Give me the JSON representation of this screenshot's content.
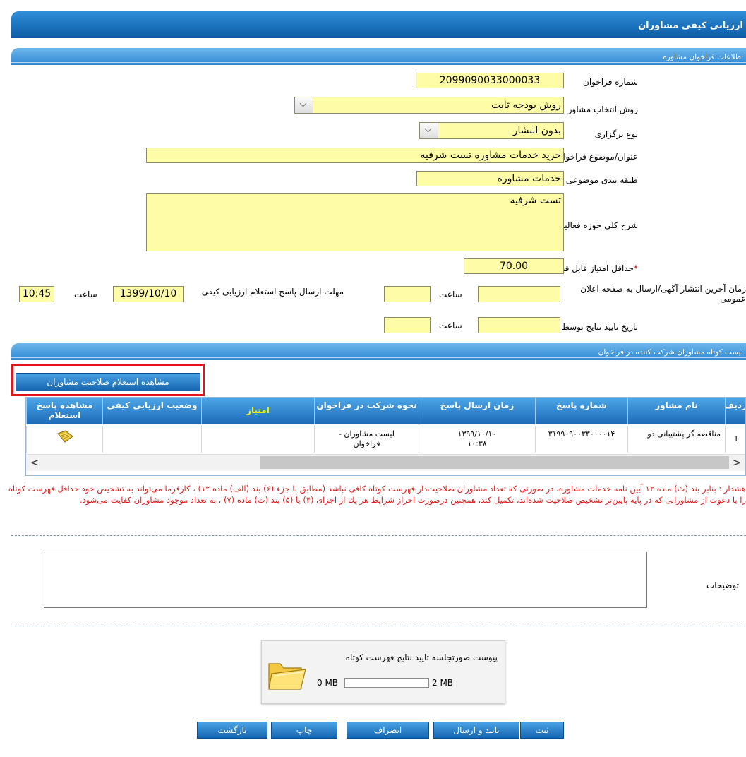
{
  "page": {
    "title": "ارزیابی کیفی مشاوران"
  },
  "sections": {
    "call_info": "اطلاعات فراخوان مشاوره",
    "short_list": "لیست کوتاه مشاوران شرکت کننده در فراخوان"
  },
  "form": {
    "call_number": {
      "label": "شماره فراخوان",
      "value": "2099090033000033"
    },
    "selection_method": {
      "label": "روش انتخاب مشاور",
      "value": "روش بودجه ثابت"
    },
    "holding_type": {
      "label": "نوع برگزاری",
      "value": "بدون انتشار"
    },
    "subject": {
      "label": "عنوان/موضوع فراخوان",
      "value": "خرید خدمات مشاوره تست شرفیه"
    },
    "category": {
      "label": "طبقه بندی موضوعی",
      "value": "خدمات مشاورة"
    },
    "description": {
      "label": "شرح کلی حوزه فعالیت",
      "value": "تست شرفیه"
    },
    "min_score": {
      "label": "حداقل امتیاز قابل قبول ارزیابی کیفی",
      "required_mark": "*",
      "value": "70.00"
    },
    "publish_time": {
      "label": "زمان آخرین انتشار آگهی/ارسال به صفحه اعلان عمومی",
      "date": "",
      "time_label": "ساعت",
      "time": ""
    },
    "response_deadline": {
      "label": "مهلت ارسال پاسخ استعلام ارزیابی کیفی",
      "date": "1399/10/10",
      "time_label": "ساعت",
      "time": "10:45"
    },
    "approval_date": {
      "label": "تاریخ تایید نتایج توسط مقام تشخیص",
      "date": "",
      "time_label": "ساعت",
      "time": ""
    }
  },
  "view_qualification_button": "مشاهده استعلام صلاحیت مشاوران",
  "grid": {
    "headers": {
      "row": "ردیف",
      "name": "نام مشاور",
      "resp_number": "شماره پاسخ",
      "resp_time": "زمان ارسال پاسخ",
      "participation": "نحوه شرکت در فراخوان",
      "score": "امتیاز",
      "status": "وضعیت ارزیابی کیفی",
      "view": "مشاهده پاسخ استعلام"
    },
    "rows": [
      {
        "row": "1",
        "name": "مناقصه گر پشتیبانی دو",
        "resp_number": "۳۱۹۹۰۹۰۰۳۳۰۰۰۰۱۴",
        "resp_time": "۱۳۹۹/۱۰/۱۰ ۱۰:۳۸",
        "participation": "لیست مشاوران - فراخوان",
        "score": "",
        "status": ""
      }
    ],
    "scroll_left": "<",
    "scroll_right": ">"
  },
  "warning": "هشدار : بنابر بند (ث) ماده ۱۲ آیین نامه خدمات مشاوره، در صورتی که تعداد مشاوران صلاحیت‌دار فهرست کوتاه کافی نباشد (مطابق با جزء (۶) بند (الف) ماده ۱۲) ، کارفرما می‌تواند به تشخیص خود حداقل فهرست کوتاه را با دعوت از مشاورانی که در پایه پایین‌تر تشخیص صلاحیت شده‌اند، تکمیل کند، همچنین درصورت احراز شرایط هر یك از اجزای (۴) یا (۵) بند (ت) ماده (۷) ، به تعداد موجود مشاوران کفایت می‌شود.",
  "notes": {
    "label": "توضیحات",
    "value": ""
  },
  "attachment": {
    "title": "پیوست صورتجلسه تایید نتایج فهرست کوتاه",
    "min_label": "0 MB",
    "max_label": "2 MB",
    "progress_fraction": 0
  },
  "actions": {
    "submit": "ثبت",
    "confirm_send": "تایید و ارسال",
    "cancel": "انصراف",
    "print": "چاپ",
    "back": "بازگشت"
  },
  "colors": {
    "header_blue": "#0c5aa5",
    "section_blue": "#2f87d3",
    "field_yellow": "#fffca7",
    "warning_red": "#e41b1b",
    "highlight_red": "#e5141c",
    "score_header_yellow": "#f6f300"
  }
}
